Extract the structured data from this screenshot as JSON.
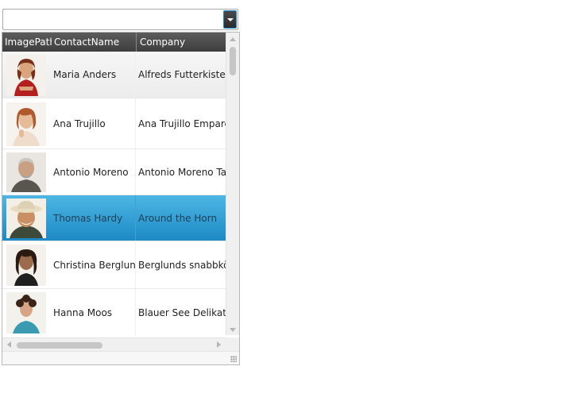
{
  "combo": {
    "value": "",
    "placeholder": ""
  },
  "grid": {
    "columns": [
      "ImagePath",
      "ContactName",
      "Company"
    ],
    "rows": [
      {
        "contact": "Maria Anders",
        "company": "Alfreds Futterkiste",
        "photo": "maria-anders-photo",
        "state": "alt"
      },
      {
        "contact": "Ana Trujillo",
        "company": "Ana Trujillo Emparedados",
        "photo": "ana-trujillo-photo",
        "state": "normal"
      },
      {
        "contact": "Antonio Moreno",
        "company": "Antonio Moreno Taquería",
        "photo": "antonio-moreno-photo",
        "state": "normal"
      },
      {
        "contact": "Thomas Hardy",
        "company": "Around the Horn",
        "photo": "thomas-hardy-photo",
        "state": "selected"
      },
      {
        "contact": "Christina Berglund",
        "company": "Berglunds snabbköp",
        "photo": "christina-berglund-photo",
        "state": "normal"
      },
      {
        "contact": "Hanna Moos",
        "company": "Blauer See Delikatessen",
        "photo": "hanna-moos-photo",
        "state": "normal"
      }
    ]
  },
  "colors": {
    "header": "#4a4a4a",
    "selected": "#2fa0d6",
    "dropdown_accent": "#1f8ed8"
  },
  "icons": {
    "dropdown": "chevron-down-icon",
    "scroll_up": "scroll-up-icon",
    "scroll_down": "scroll-down-icon",
    "scroll_left": "scroll-left-icon",
    "scroll_right": "scroll-right-icon",
    "resize": "resize-grip-icon"
  }
}
